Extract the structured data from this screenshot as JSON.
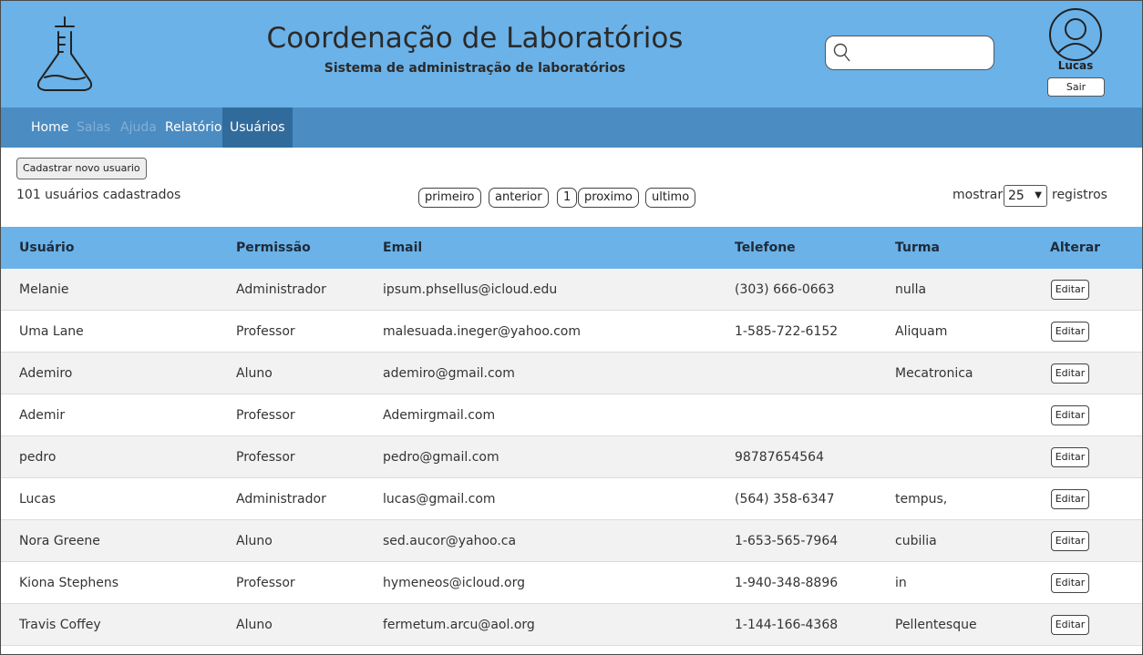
{
  "header": {
    "title": "Coordenação de Laboratórios",
    "subtitle": "Sistema de administração de laboratórios",
    "search_value": "",
    "user_name": "Lucas",
    "logout_label": "Sair"
  },
  "nav": {
    "items": [
      {
        "label": "Home",
        "state": "normal"
      },
      {
        "label": "Salas",
        "state": "disabled"
      },
      {
        "label": "Ajuda",
        "state": "disabled"
      },
      {
        "label": "Relatório",
        "state": "normal"
      },
      {
        "label": "Usuários",
        "state": "active"
      }
    ]
  },
  "controls": {
    "new_user_label": "Cadastrar novo usuario",
    "count_text": "101 usuários cadastrados",
    "pager": {
      "first": "primeiro",
      "prev": "anterior",
      "page": "1",
      "next": "proximo",
      "last": "ultimo"
    },
    "show_label": "mostrar",
    "show_value": "25",
    "show_suffix": "registros"
  },
  "table": {
    "headers": [
      "Usuário",
      "Permissão",
      "Email",
      "Telefone",
      "Turma",
      "Alterar"
    ],
    "edit_label": "Editar",
    "rows": [
      {
        "usuario": "Melanie",
        "permissao": "Administrador",
        "email": "ipsum.phsellus@icloud.edu",
        "telefone": "(303) 666-0663",
        "turma": "nulla"
      },
      {
        "usuario": "Uma Lane",
        "permissao": "Professor",
        "email": "malesuada.ineger@yahoo.com",
        "telefone": "1-585-722-6152",
        "turma": "Aliquam"
      },
      {
        "usuario": "Ademiro",
        "permissao": "Aluno",
        "email": "ademiro@gmail.com",
        "telefone": "",
        "turma": "Mecatronica"
      },
      {
        "usuario": "Ademir",
        "permissao": "Professor",
        "email": "Ademirgmail.com",
        "telefone": "",
        "turma": ""
      },
      {
        "usuario": "pedro",
        "permissao": "Professor",
        "email": "pedro@gmail.com",
        "telefone": "98787654564",
        "turma": ""
      },
      {
        "usuario": "Lucas",
        "permissao": "Administrador",
        "email": "lucas@gmail.com",
        "telefone": "(564) 358-6347",
        "turma": "tempus,"
      },
      {
        "usuario": "Nora Greene",
        "permissao": "Aluno",
        "email": "sed.aucor@yahoo.ca",
        "telefone": "1-653-565-7964",
        "turma": "cubilia"
      },
      {
        "usuario": "Kiona Stephens",
        "permissao": "Professor",
        "email": "hymeneos@icloud.org",
        "telefone": "1-940-348-8896",
        "turma": "in"
      },
      {
        "usuario": "Travis Coffey",
        "permissao": "Aluno",
        "email": "fermetum.arcu@aol.org",
        "telefone": "1-144-166-4368",
        "turma": "Pellentesque"
      }
    ]
  },
  "colors": {
    "header_bg": "#6bb2e8",
    "nav_bg": "#4b8cc2",
    "nav_active_bg": "#316b9b",
    "row_alt_bg": "#f2f2f2"
  },
  "icons": [
    "flask-icon",
    "search-icon",
    "user-avatar-icon",
    "chevron-down-icon"
  ]
}
